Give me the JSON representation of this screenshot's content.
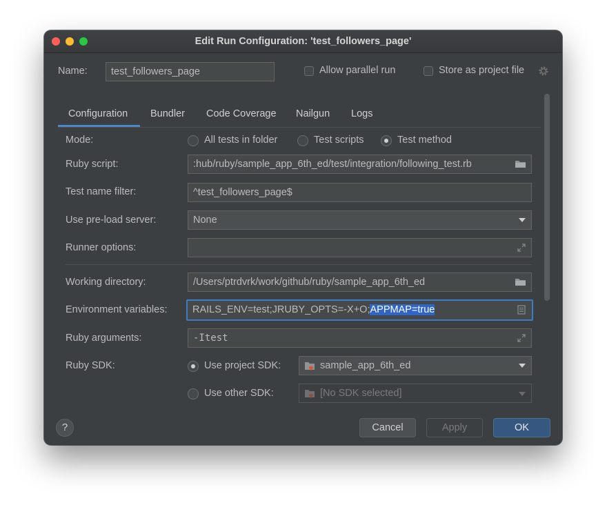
{
  "window": {
    "title": "Edit Run Configuration: 'test_followers_page'"
  },
  "header": {
    "name_label": "Name:",
    "name_value": "test_followers_page",
    "allow_parallel_label": "Allow parallel run",
    "store_project_label": "Store as project file"
  },
  "tabs": [
    "Configuration",
    "Bundler",
    "Code Coverage",
    "Nailgun",
    "Logs"
  ],
  "form": {
    "mode_label": "Mode:",
    "mode_options": [
      "All tests in folder",
      "Test scripts",
      "Test method"
    ],
    "mode_selected": "Test method",
    "ruby_script_label": "Ruby script:",
    "ruby_script_value": ":hub/ruby/sample_app_6th_ed/test/integration/following_test.rb",
    "test_name_filter_label": "Test name filter:",
    "test_name_filter_value": "^test_followers_page$",
    "preload_label": "Use pre-load server:",
    "preload_value": "None",
    "runner_options_label": "Runner options:",
    "runner_options_value": "",
    "working_dir_label": "Working directory:",
    "working_dir_value": "/Users/ptrdvrk/work/github/ruby/sample_app_6th_ed",
    "env_label": "Environment variables:",
    "env_value_plain": "RAILS_ENV=test;JRUBY_OPTS=-X+O;",
    "env_value_selected": "APPMAP=true",
    "ruby_args_label": "Ruby arguments:",
    "ruby_args_value": "-Itest",
    "ruby_sdk_label": "Ruby SDK:",
    "use_project_sdk_label": "Use project SDK:",
    "project_sdk_value": "sample_app_6th_ed",
    "use_other_sdk_label": "Use other SDK:",
    "other_sdk_value": "[No SDK selected]"
  },
  "footer": {
    "help_label": "?",
    "cancel_label": "Cancel",
    "apply_label": "Apply",
    "ok_label": "OK"
  },
  "colors": {
    "dialog_bg": "#3c3f41",
    "accent": "#4a88c7",
    "selection": "#2f65ca",
    "ok_button": "#365880"
  },
  "icons": [
    "gear-icon",
    "folder-icon",
    "expand-icon",
    "document-icon",
    "chevron-down-icon",
    "ruby-sdk-icon"
  ]
}
